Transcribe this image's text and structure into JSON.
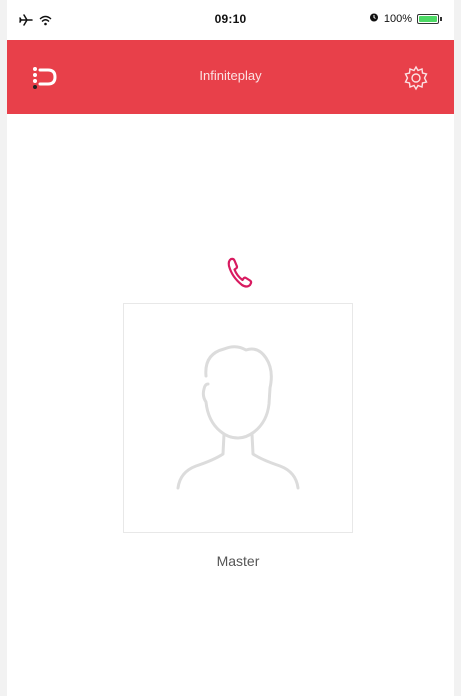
{
  "status_bar": {
    "time": "09:10",
    "battery_text": "100%",
    "battery_level": 1.0,
    "icons": [
      "airplane-icon",
      "wifi-icon",
      "alarm-icon",
      "battery-icon"
    ]
  },
  "nav": {
    "title": "Infiniteplay",
    "background_color": "#e8404a",
    "logo_icon": "app-logo-icon",
    "settings_icon": "gear-icon"
  },
  "call": {
    "icon": "phone-icon",
    "icon_color": "#d81b60",
    "contact_name": "Master",
    "avatar_icon": "avatar-placeholder-icon"
  },
  "colors": {
    "accent": "#e8404a",
    "battery_green": "#4cd964"
  }
}
